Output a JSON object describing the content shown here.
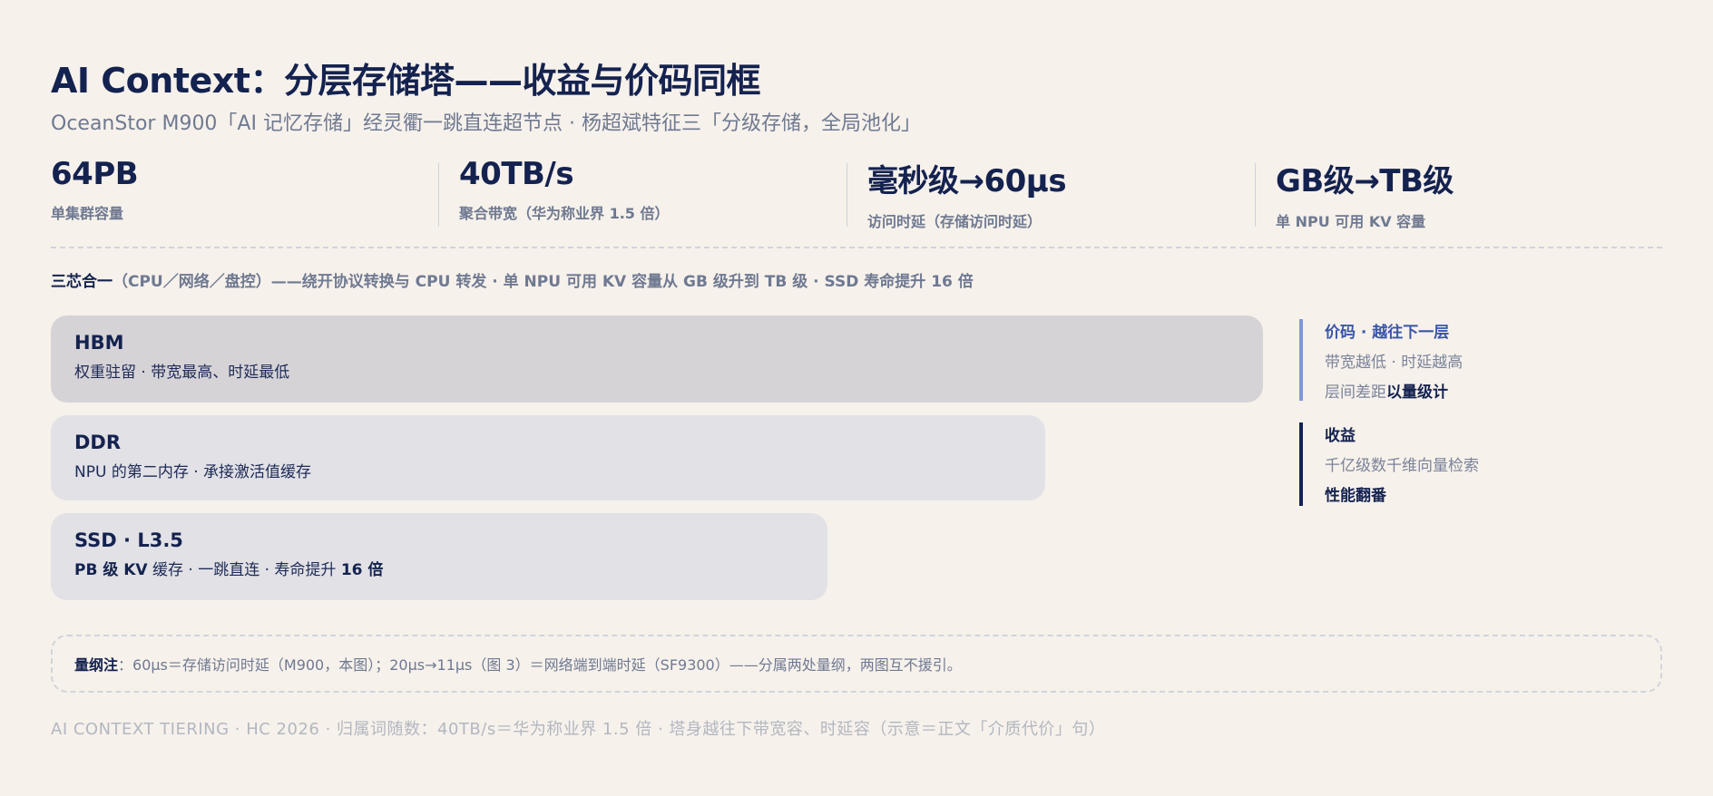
{
  "title": "AI Context：分层存储塔——收益与价码同框",
  "subtitle": "OceanStor M900「AI 记忆存储」经灵衢一跳直连超节点 · 杨超斌特征三「分级存储，全局池化」",
  "stats": [
    {
      "value": "64PB",
      "label": "单集群容量"
    },
    {
      "value": "40TB/s",
      "label": "聚合带宽（华为称业界 1.5 倍）"
    },
    {
      "value": "毫秒级→60µs",
      "label": "访问时延（存储访问时延）"
    },
    {
      "value": "GB级→TB级",
      "label": "单 NPU 可用 KV 容量"
    }
  ],
  "summary": {
    "lead": "三芯合一",
    "text": "（CPU／网络／盘控）——绕开协议转换与 CPU 转发 · 单 NPU 可用 KV 容量从 GB 级升到 TB 级 · SSD 寿命提升 16 倍"
  },
  "tiers": [
    {
      "name": "HBM",
      "desc": "权重驻留 · 带宽最高、时延最低"
    },
    {
      "name": "DDR",
      "desc": "NPU 的第二内存 · 承接激活值缓存"
    },
    {
      "name": "SSD · L3.5",
      "desc_b1": "PB 级 KV",
      "desc_mid": " 缓存 · 一跳直连 · 寿命提升 ",
      "desc_b2": "16 倍"
    }
  ],
  "side_cost": {
    "heading": "价码 · 越往下一层",
    "line1": "带宽越低 · 时延越高",
    "line2_prefix": "层间差距",
    "line2_bold": "以量级计"
  },
  "side_gain": {
    "heading": "收益",
    "line1": "千亿级数千维向量检索",
    "line2_bold": "性能翻番"
  },
  "note": {
    "lead": "量纲注",
    "text": "：60µs＝存储访问时延（M900，本图）；20µs→11µs（图 3）＝网络端到端时延（SF9300）——分属两处量纲，两图互不援引。"
  },
  "footer": "AI CONTEXT TIERING · HC 2026 · 归属词随数：40TB/s＝华为称业界 1.5 倍 · 塔身越往下带宽容、时延容（示意＝正文「介质代价」句）"
}
